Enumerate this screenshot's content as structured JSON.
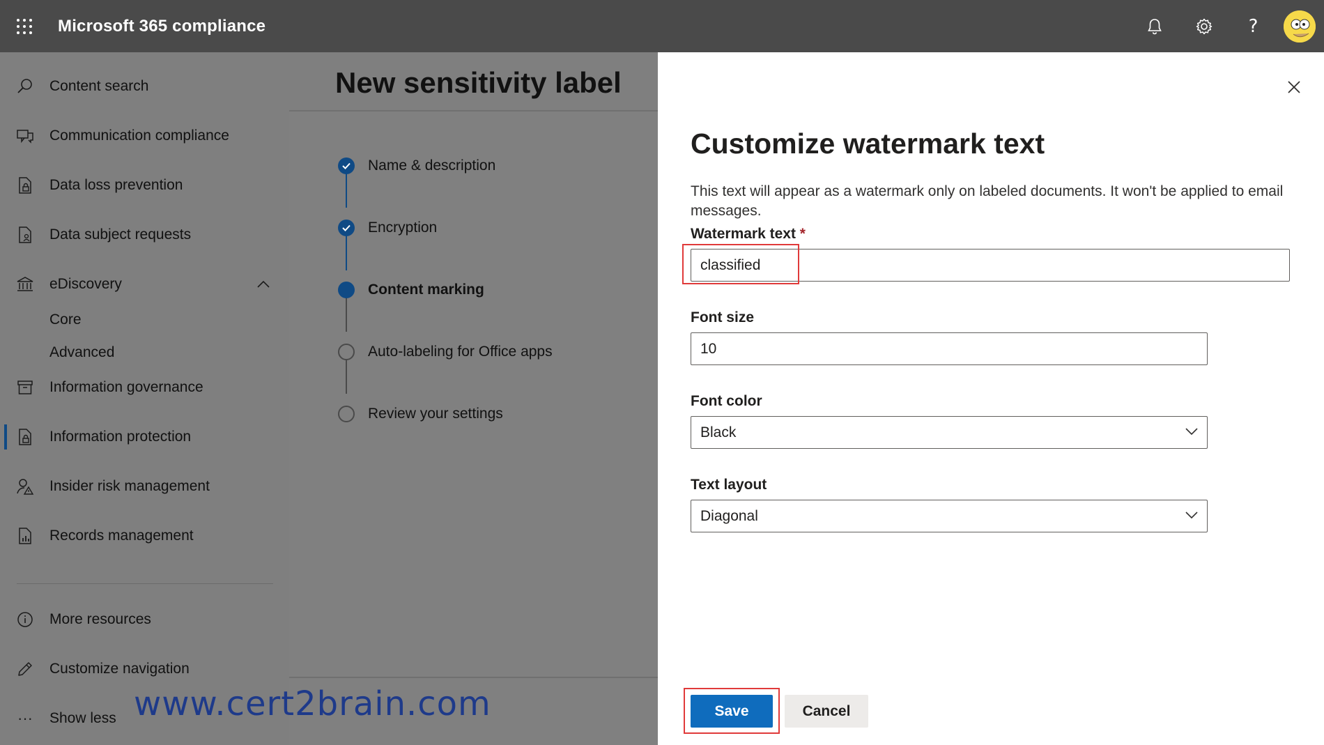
{
  "topbar": {
    "app_title": "Microsoft 365 compliance",
    "icons": [
      "waffle-icon",
      "bell-icon",
      "gear-icon",
      "help-icon",
      "avatar"
    ],
    "help_glyph": "?"
  },
  "nav": {
    "items": [
      {
        "label": "Content search",
        "icon": "search-icon"
      },
      {
        "label": "Communication compliance",
        "icon": "chat-icon"
      },
      {
        "label": "Data loss prevention",
        "icon": "document-lock-icon"
      },
      {
        "label": "Data subject requests",
        "icon": "document-person-icon"
      },
      {
        "label": "eDiscovery",
        "icon": "bank-icon",
        "expanded": true
      },
      {
        "label": "Information governance",
        "icon": "archive-icon"
      },
      {
        "label": "Information protection",
        "icon": "document-lock-icon",
        "active": true
      },
      {
        "label": "Insider risk management",
        "icon": "person-warning-icon"
      },
      {
        "label": "Records management",
        "icon": "document-chart-icon"
      }
    ],
    "ediscovery_sub": [
      "Core",
      "Advanced"
    ],
    "bottom": [
      {
        "label": "More resources",
        "icon": "info-icon"
      },
      {
        "label": "Customize navigation",
        "icon": "pencil-icon"
      },
      {
        "label": "Show less",
        "icon": "ellipsis-icon"
      }
    ],
    "ellipsis_glyph": "···"
  },
  "wizard": {
    "title": "New sensitivity label",
    "steps": [
      {
        "label": "Name & description",
        "state": "done"
      },
      {
        "label": "Encryption",
        "state": "done"
      },
      {
        "label": "Content marking",
        "state": "current"
      },
      {
        "label": "Auto-labeling for Office apps",
        "state": "todo"
      },
      {
        "label": "Review your settings",
        "state": "todo"
      }
    ]
  },
  "watermark_text": "www.cert2brain.com",
  "flyout": {
    "title": "Customize watermark text",
    "description": "This text will appear as a watermark only on labeled documents. It won't be applied to email messages.",
    "watermark_label": "Watermark text",
    "required_mark": "*",
    "watermark_value": "classified",
    "font_size_label": "Font size",
    "font_size_value": "10",
    "font_color_label": "Font color",
    "font_color_value": "Black",
    "text_layout_label": "Text layout",
    "text_layout_value": "Diagonal",
    "save_label": "Save",
    "cancel_label": "Cancel"
  },
  "colors": {
    "accent": "#0f6cbd",
    "highlight": "#e03a3a",
    "topbar": "#4a4a4a",
    "watermark": "#1e3a8a"
  }
}
